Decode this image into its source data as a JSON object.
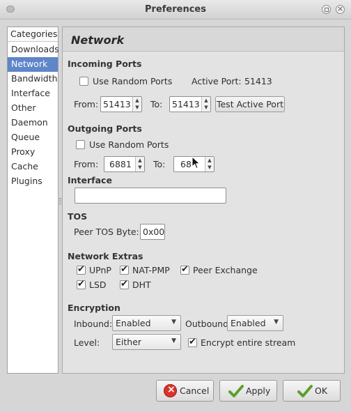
{
  "window": {
    "title": "Preferences"
  },
  "categories": {
    "header": "Categories",
    "items": [
      "Downloads",
      "Network",
      "Bandwidth",
      "Interface",
      "Other",
      "Daemon",
      "Queue",
      "Proxy",
      "Cache",
      "Plugins"
    ],
    "selected": "Network"
  },
  "panel": {
    "title": "Network"
  },
  "incoming": {
    "title": "Incoming Ports",
    "random_label": "Use Random Ports",
    "random_checked": false,
    "active_port_label": "Active Port:",
    "active_port_value": "51413",
    "from_label": "From:",
    "from_value": "51413",
    "to_label": "To:",
    "to_value": "51413",
    "test_button": "Test Active Port"
  },
  "outgoing": {
    "title": "Outgoing Ports",
    "random_label": "Use Random Ports",
    "random_checked": false,
    "from_label": "From:",
    "from_value": "6881",
    "to_label": "To:",
    "to_value": "68"
  },
  "interface": {
    "title": "Interface",
    "value": ""
  },
  "tos": {
    "title": "TOS",
    "label": "Peer TOS Byte:",
    "value": "0x00"
  },
  "extras": {
    "title": "Network Extras",
    "upnp": "UPnP",
    "natpmp": "NAT-PMP",
    "pex": "Peer Exchange",
    "lsd": "LSD",
    "dht": "DHT"
  },
  "encryption": {
    "title": "Encryption",
    "inbound_label": "Inbound:",
    "inbound_value": "Enabled",
    "outbound_label": "Outbound:",
    "outbound_value": "Enabled",
    "level_label": "Level:",
    "level_value": "Either",
    "encrypt_label": "Encrypt entire stream"
  },
  "buttons": {
    "cancel": "Cancel",
    "apply": "Apply",
    "ok": "OK"
  },
  "colors": {
    "selection": "#5e86c8",
    "cancel_icon": "#d9342b",
    "check_icon": "#5aa02c"
  }
}
